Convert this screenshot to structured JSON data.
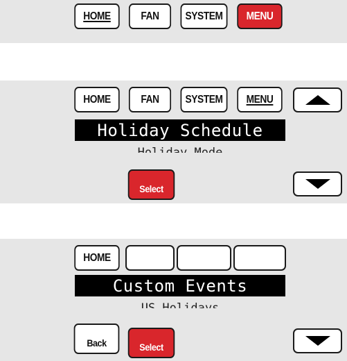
{
  "colors": {
    "panel_bg": "#e6e6e6",
    "menu_red": "#d9262c",
    "lcd_bg": "#000000"
  },
  "screen1": {
    "buttons": {
      "home": "HOME",
      "fan": "FAN",
      "system": "SYSTEM",
      "menu": "MENU"
    }
  },
  "screen2": {
    "buttons": {
      "home": "HOME",
      "fan": "FAN",
      "system": "SYSTEM",
      "menu": "MENU",
      "select": "Select"
    },
    "display": {
      "selected": "Holiday Schedule",
      "next": "Holiday Mode"
    },
    "icons": {
      "up": "up-arrow-icon",
      "down": "down-arrow-icon"
    }
  },
  "screen3": {
    "buttons": {
      "home": "HOME",
      "back": "Back",
      "select": "Select"
    },
    "display": {
      "selected": "Custom Events",
      "next": "US Holidays"
    },
    "icons": {
      "down": "down-arrow-icon"
    }
  }
}
